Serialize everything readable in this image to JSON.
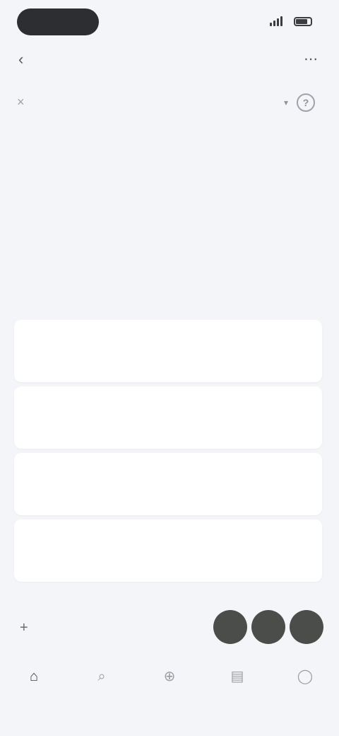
{
  "status_bar": {
    "time": "",
    "network": ""
  },
  "header": {
    "title": ""
  },
  "toolbar": {
    "select_label": ""
  },
  "description": {
    "text": "",
    "highlight": ""
  },
  "options": [
    {
      "label": ""
    },
    {
      "label": ""
    },
    {
      "label": ""
    },
    {
      "label": ""
    }
  ],
  "action_row": {
    "label": "",
    "avatars": [
      "",
      "",
      ""
    ]
  },
  "tabs": [
    {
      "label": "",
      "icon": "home-icon"
    },
    {
      "label": "",
      "icon": "search-icon"
    },
    {
      "label": "",
      "icon": "add-icon"
    },
    {
      "label": "",
      "icon": "inbox-icon"
    },
    {
      "label": "",
      "icon": "profile-icon"
    }
  ],
  "colors": {
    "background": "#f3f5f8",
    "card": "#ffffff",
    "dark": "#2c2e31"
  }
}
